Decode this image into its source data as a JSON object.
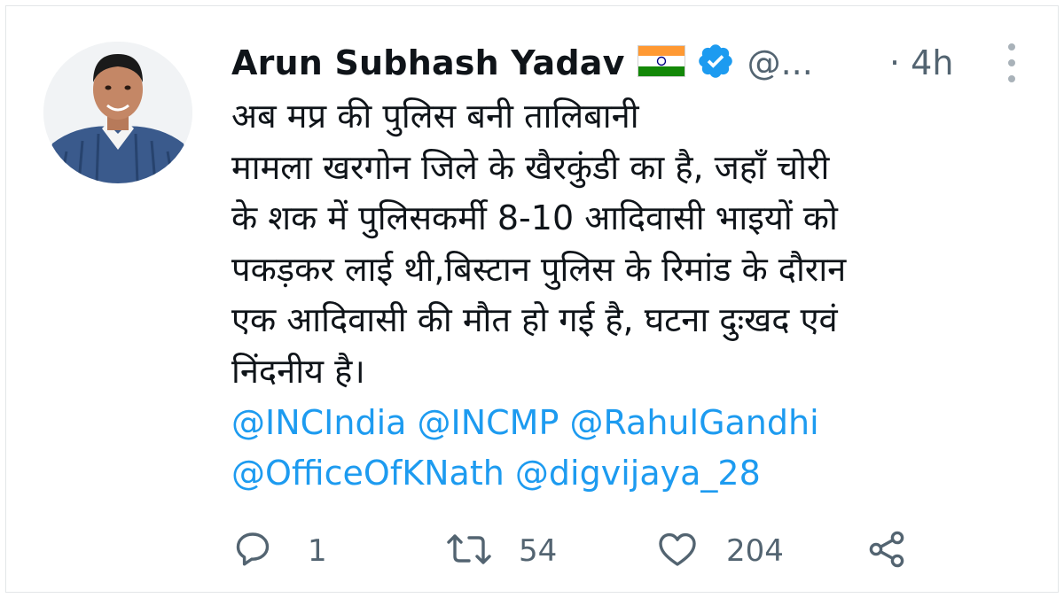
{
  "tweet": {
    "author_name": "Arun Subhash Yadav",
    "flag_icon": "india-flag-icon",
    "verified_icon": "verified-badge-icon",
    "handle": "@...",
    "time": "· 4h",
    "more_icon": "more-vertical-icon",
    "text_lines": [
      "अब मप्र की पुलिस बनी तालिबानी",
      "मामला खरगोन जिले के खैरकुंडी का है, जहाँ चोरी",
      "के शक में पुलिसकर्मी 8-10 आदिवासी भाइयों को",
      "पकड़कर लाई थी,बिस्टान पुलिस के रिमांड के दौरान",
      "एक आदिवासी की मौत हो गई है, घटना दुःखद एवं",
      "निंदनीय है।"
    ],
    "mentions_line1": [
      "@INCIndia",
      "@INCMP",
      "@RahulGandhi"
    ],
    "mentions_line2": [
      "@OfficeOfKNath",
      "@digvijaya_28"
    ]
  },
  "actions": {
    "reply": {
      "icon": "reply-icon",
      "count": "1"
    },
    "retweet": {
      "icon": "retweet-icon",
      "count": "54"
    },
    "like": {
      "icon": "heart-icon",
      "count": "204"
    },
    "share": {
      "icon": "share-icon"
    }
  },
  "colors": {
    "text": "#0f1419",
    "secondary": "#536471",
    "link": "#1d9bf0",
    "verified": "#1d9bf0"
  }
}
